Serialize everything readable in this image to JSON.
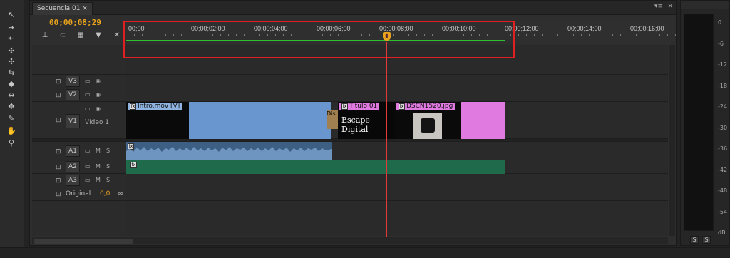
{
  "tab": {
    "label": "Secuencia 01",
    "close": "×"
  },
  "panel_menu": "▾≡",
  "panel_close": "×",
  "timecode": "00;00;08;29",
  "ruler_ticks": [
    "00;00",
    "00;00;02;00",
    "00;00;04;00",
    "00;00;06;00",
    "00;00;08;00",
    "00;00;10;00",
    "00;00;12;00",
    "00;00;14;00",
    "00;00;16;00"
  ],
  "tracks": {
    "v3": "V3",
    "v2": "V2",
    "v1": "V1",
    "v1_name": "Vídeo 1",
    "a1": "A1",
    "a2": "A2",
    "a3": "A3",
    "mute": "M",
    "solo": "S",
    "original": "Original",
    "original_value": "0,0"
  },
  "clips": {
    "intro": "Intro.mov [V]",
    "titulo": "Titulo 01",
    "titulo_text": "Escape Digital",
    "dscn": "DSCN1520.jpg",
    "dis": "Dis"
  },
  "meter_labels": [
    "0",
    "-6",
    "-12",
    "-18",
    "-24",
    "-30",
    "-36",
    "-42",
    "-48",
    "-54",
    "dB"
  ],
  "meter_buttons": [
    "S",
    "S"
  ],
  "colors": {
    "accent": "#e8a21c",
    "playhead": "#e23a3a",
    "highlight": "#e02020",
    "video_clip": "#6a96cf",
    "title_clip": "#e07ae0",
    "audio_clip": "#1f6a4a"
  }
}
